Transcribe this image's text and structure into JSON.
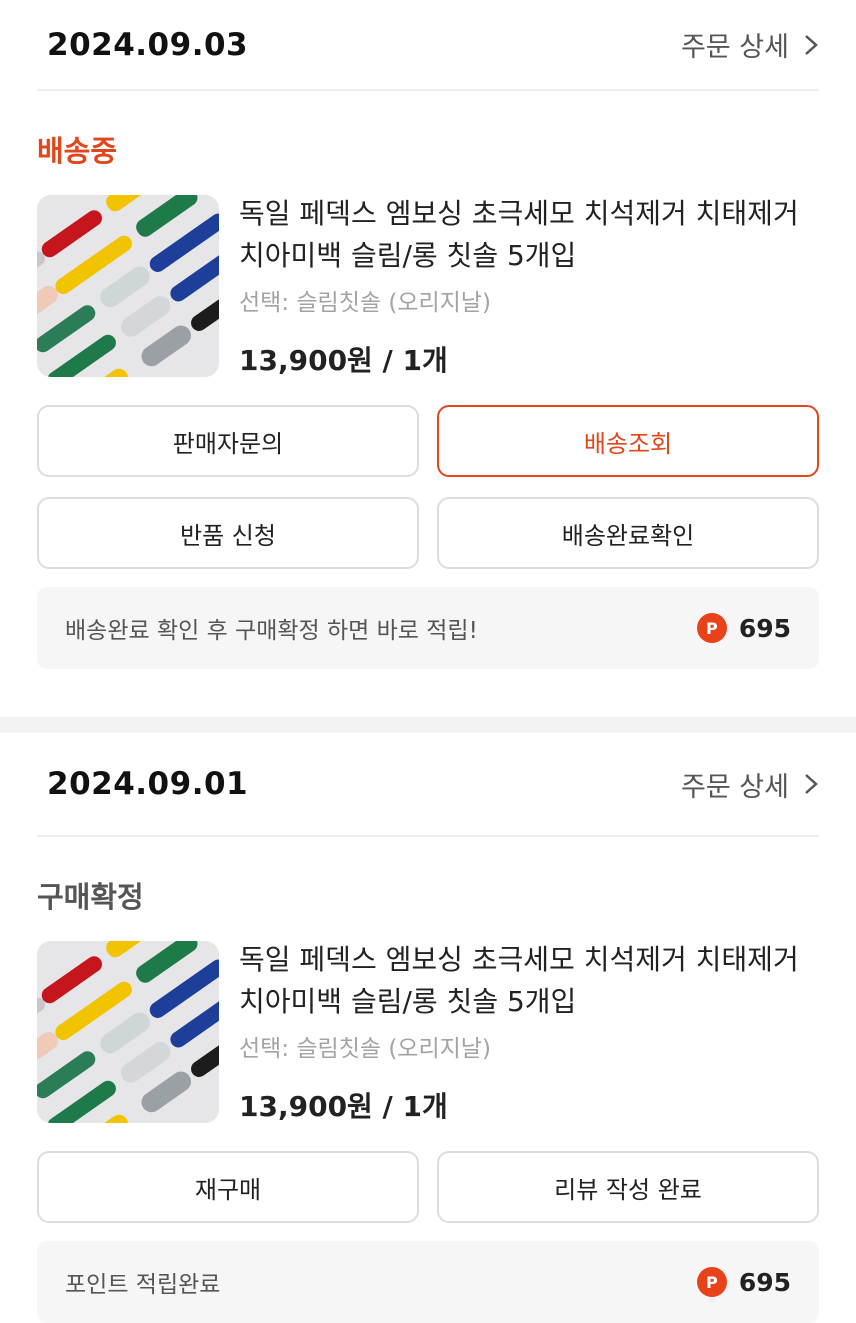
{
  "colors": {
    "accent": "#e0471c",
    "status_shipping": "#e0471c",
    "status_confirmed": "#555555"
  },
  "orders": [
    {
      "date": "2024.09.03",
      "detail_label": "주문 상세",
      "status": "배송중",
      "status_color": "#e0471c",
      "product_name": "독일 페덱스 엠보싱 초극세모 치석제거 치태제거 치아미백 슬림/롱 칫솔 5개입",
      "option": "선택: 슬림칫솔 (오리지날)",
      "price": "13,900원 / 1개",
      "buttons": [
        "판매자문의",
        "배송조회",
        "반품 신청",
        "배송완료확인"
      ],
      "notice": "배송완료 확인 후 구매확정 하면 바로 적립!",
      "point_badge": "P",
      "points": "695"
    },
    {
      "date": "2024.09.01",
      "detail_label": "주문 상세",
      "status": "구매확정",
      "status_color": "#555555",
      "product_name": "독일 페덱스 엠보싱 초극세모 치석제거 치태제거 치아미백 슬림/롱 칫솔 5개입",
      "option": "선택: 슬림칫솔 (오리지날)",
      "price": "13,900원 / 1개",
      "buttons": [
        "재구매",
        "리뷰 작성 완료"
      ],
      "notice": "포인트 적립완료",
      "point_badge": "P",
      "points": "695"
    }
  ]
}
